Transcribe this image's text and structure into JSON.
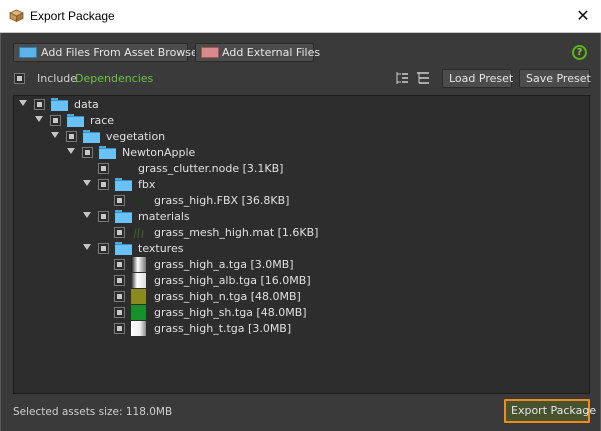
{
  "window": {
    "title": "Export Package",
    "close_glyph": "✕"
  },
  "toolbar": {
    "add_asset_label": "Add Files From Asset Browser",
    "add_external_label": "Add External Files",
    "help_glyph": "?"
  },
  "include": {
    "label": "Include",
    "link": "Dependencies"
  },
  "preset": {
    "load_label": "Load Preset",
    "save_label": "Save Preset"
  },
  "tree": {
    "data": "data",
    "race": "race",
    "vegetation": "vegetation",
    "newton": "NewtonApple",
    "clutter": "grass_clutter.node [3.1KB]",
    "fbx": "fbx",
    "fbx_file": "grass_high.FBX [36.8KB]",
    "materials": "materials",
    "mat_file": "grass_mesh_high.mat [1.6KB]",
    "textures": "textures",
    "tex": [
      {
        "label": "grass_high_a.tga [3.0MB]"
      },
      {
        "label": "grass_high_alb.tga [16.0MB]"
      },
      {
        "label": "grass_high_n.tga [48.0MB]"
      },
      {
        "label": "grass_high_sh.tga [48.0MB]"
      },
      {
        "label": "grass_high_t.tga [3.0MB]"
      }
    ]
  },
  "status": {
    "selected_size": "Selected assets size: 118.0MB"
  },
  "footer": {
    "export_label": "Export Package"
  },
  "colors": {
    "accent_orange": "#f28a1c",
    "link_green": "#6cc24a",
    "folder_blue": "#6bc2f2"
  }
}
